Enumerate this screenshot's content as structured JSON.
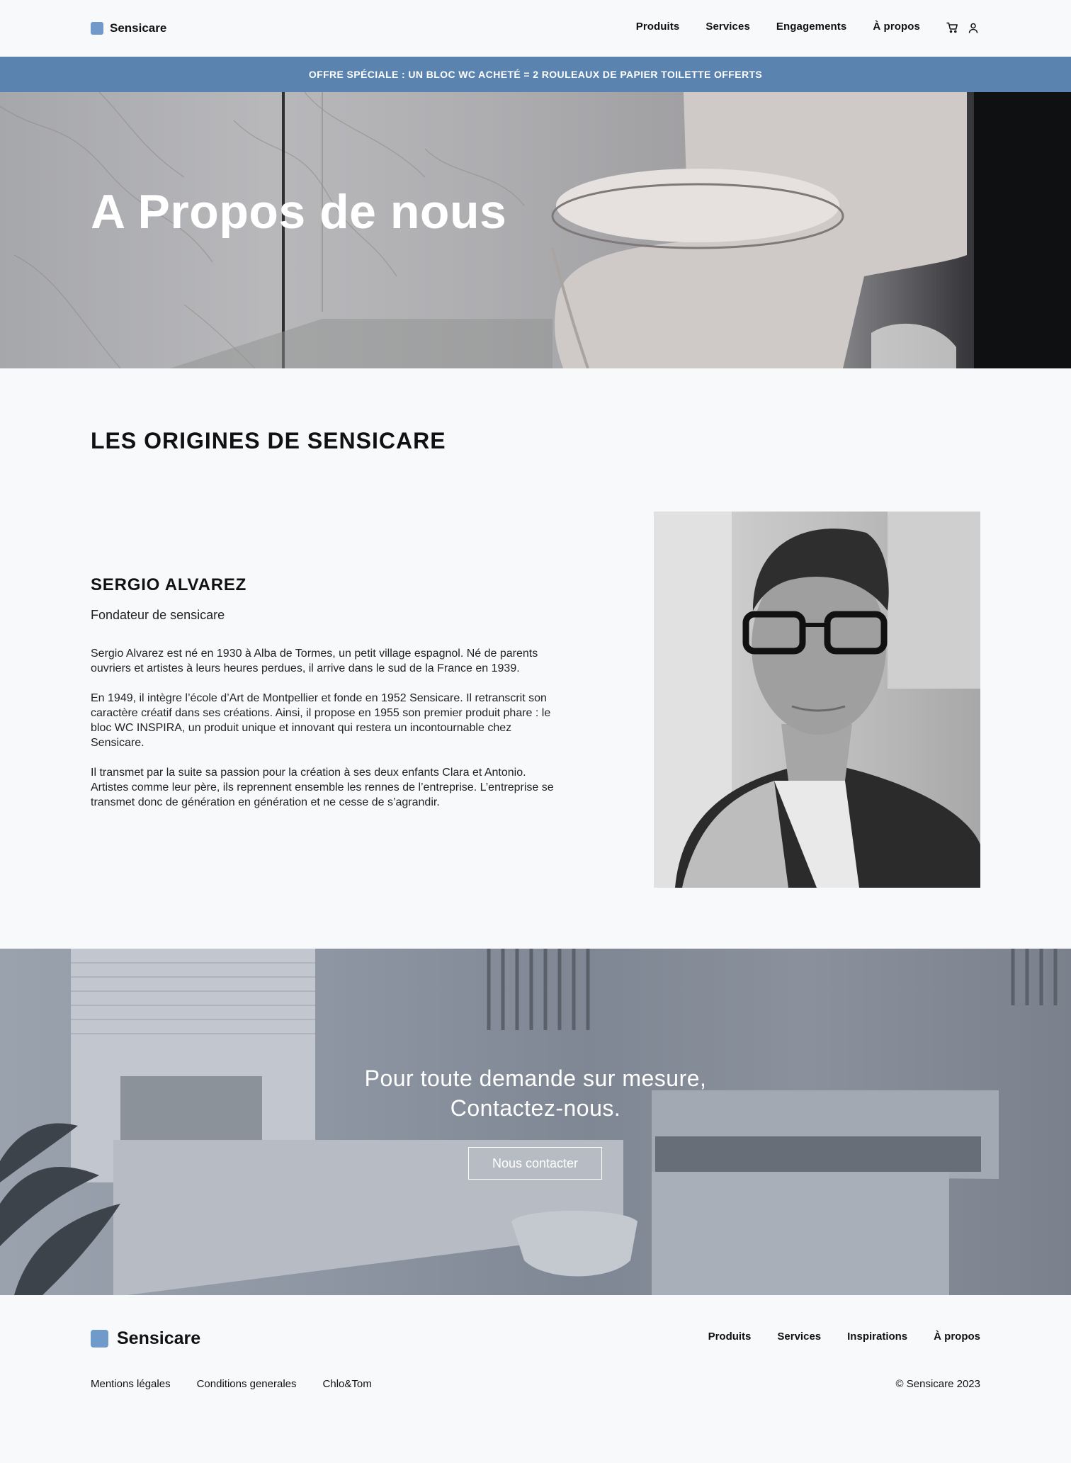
{
  "header": {
    "logo_text": "Sensicare",
    "nav": [
      "Produits",
      "Services",
      "Engagements",
      "À propos"
    ],
    "icons": [
      "cart-icon",
      "user-icon"
    ]
  },
  "promo": {
    "text": "OFFRE SPÉCIALE : UN BLOC WC ACHETÉ = 2 ROULEAUX DE PAPIER TOILETTE OFFERTS"
  },
  "hero": {
    "title": "A Propos de nous"
  },
  "origins": {
    "section_title": "LES ORIGINES DE SENSICARE",
    "name": "SERGIO ALVAREZ",
    "role": "Fondateur de sensicare",
    "bio": [
      "Sergio Alvarez est né en 1930 à Alba de Tormes, un petit village espagnol. Né de parents ouvriers et artistes à leurs heures perdues, il arrive dans le sud de la France en 1939.",
      "En 1949, il intègre l’école d’Art de Montpellier et fonde en 1952 Sensicare. Il retranscrit son caractère créatif dans ses créations. Ainsi, il propose en 1955 son premier produit phare : le bloc WC INSPIRA, un produit unique et innovant qui restera un incontournable chez Sensicare.",
      "Il transmet par la suite sa passion pour la création à ses deux enfants Clara et Antonio. Artistes comme leur père, ils reprennent ensemble les rennes de l’entreprise. L’entreprise se transmet donc de génération en génération et ne cesse de s’agrandir."
    ]
  },
  "cta": {
    "line1": "Pour toute demande sur mesure,",
    "line2": "Contactez-nous.",
    "button": "Nous contacter"
  },
  "footer": {
    "logo_text": "Sensicare",
    "nav": [
      "Produits",
      "Services",
      "Inspirations",
      "À propos"
    ],
    "links": [
      "Mentions légales",
      "Conditions generales",
      "Chlo&Tom"
    ],
    "copyright": "© Sensicare 2023"
  },
  "colors": {
    "accent": "#6f9ac9",
    "promo_bg": "#5a83b0",
    "page_bg": "#f8f9fb"
  }
}
